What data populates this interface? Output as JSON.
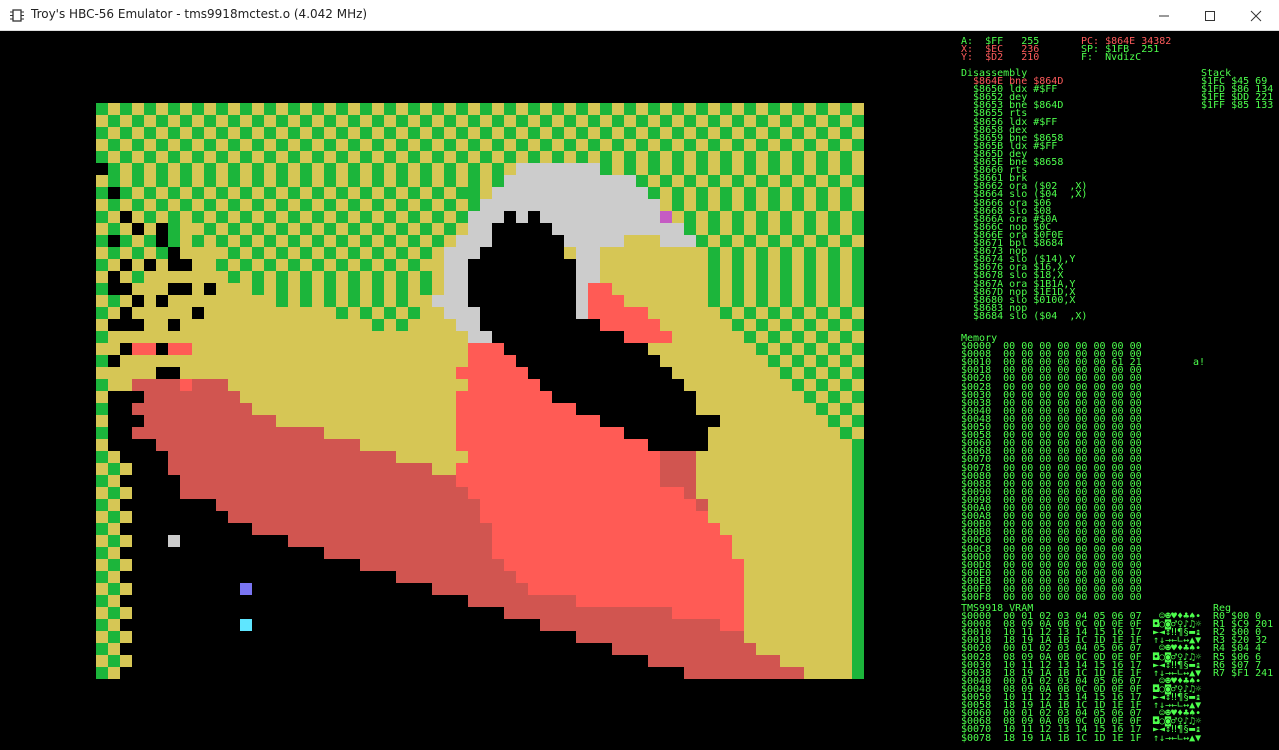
{
  "window": {
    "title": "Troy's HBC-56 Emulator - tms9918mctest.o (4.042 MHz)",
    "icons": {
      "app": "hbc56-chip-icon",
      "minimize": "minimize-icon",
      "maximize": "maximize-icon",
      "close": "close-icon"
    }
  },
  "colors": {
    "debug_green": "#4dff4d",
    "debug_red": "#ff5c5c",
    "palette": {
      "0": "#000000",
      "1": "#1cb53b",
      "2": "#d6c655",
      "3": "#ff5b55",
      "4": "#d15550",
      "5": "#cccccc",
      "6": "#7a75f2",
      "7": "#5fe6ff",
      "8": "#c55bc3",
      "9": "#e2cb84",
      "a": "#45c545"
    }
  },
  "emulator_screen": {
    "description": "TMS9918 multicolor mode bitmap (64x48 blocks)",
    "pixels": [
      "1212121212121212121212121212121212121212121212121212121212121212",
      "2121212121212121212121212121212121212121212121212121212121212121",
      "1212121212121212121212121212121212121212121212121212121212121212",
      "2121212121212121212121212121212121212121212121212121212121212121",
      "1212121212121212121212121212121212121212121212121212121212121212",
      "0121212121212121212121212121212121255555551212121212121212121212",
      "2121212121212121212121212121212121555555555551212121212121212121",
      "1012121212121212121212121212121125555555555555121212121212121212",
      "2121212121212121212121212121212155555555555555521212121212121212",
      "1202121212121212121212121212121555050555555555582121212121212121",
      "2120201221212121212121212121212550000055555555555121212121212121",
      "1012101212121212121212121212125550000005555522255512121212121212",
      "2121210222212121212121212121255500000002552222222221212121212121",
      "1202020022121212121212121212255000000000552222222221212121212121",
      "2021222222212121212121212121255000000000552222222221212121212121",
      "1002220020222121212121212121255000000000533222222221212121212121",
      "2120202222222221212121212122555000000000533322222221212121212121",
      "1202222202222222222212121212255500000000533333222222121212121212",
      "2000220222222222222222212122225500000000003333322222212121212121",
      "1222222222222222222222222222222550000000000033332222221212121212",
      "2203303322222222222222222222222333000000000000222222222121212121",
      "1022222222222222222222222222222333300000000000022222222212121212",
      "2222200222222222222222222222223333330000000000002222222221212121",
      "1224444344422222222222222222222333333000000000000222222222121212",
      "2000444444442222222222222222223333333300000000000022222222212121",
      "1004444444444222222222222222223333333333000000000022222222221212",
      "2000444444444442222222222222223333333333330000000000222222222121",
      "1004444444444444444222222222223333333333333300000002222222222212",
      "2000044444444444444444222222223333333333333333000002222222222221",
      "1200004444444444444444444222222333333333333333344422222222222221",
      "2120004444444444444444444444223333333333333333344422222222222221",
      "1200000444444444444444444444443333333333333333344422222222222221",
      "2120000444444444444444444444444333333333333333333422222222222221",
      "1200000000444444444444444444444433333333333333333342222222222221",
      "2120000000044444444444444444444433333333333333333332222222222221",
      "1200000000000444444444444444444443333333333333333333222222222221",
      "2120005000000000444444444444444443333333333333333333322222222221",
      "1200000000000000000444444444444443333333333333333333322222222221",
      "2120000000000000000000444444444444333333333333333333332222222221",
      "1200000000000000000000000444444444433333333333333333332222222221",
      "2120000000006000000000000000444444443333333333333333332222222221",
      "1200000000000000000000000000000444444444333333333333332222222221",
      "2120000000000000000000000000000000444444444444443333332222222221",
      "1200000000007000000000000000000000000444444444444444332222222221",
      "2120000000000000000000000000000000000000444444444444442222222221",
      "1200000000000000000000000000000000000000000444444444444222222221",
      "2120000000000000000000000000000000000000000000444444444442222221",
      "1200000000000000000000000000000000000000000000000444444444422221"
    ]
  },
  "debugger": {
    "registers": [
      {
        "text": "A:  $FF   255",
        "color": "green"
      },
      {
        "text": "X:  $EC   236",
        "color": "red"
      },
      {
        "text": "Y:  $D2   210",
        "color": "red"
      },
      {
        "text": "PC: $864E 34382",
        "color": "red"
      },
      {
        "text": "SP: $1FB  251",
        "color": "green"
      },
      {
        "text": "F:  NvdizC",
        "color": "green"
      }
    ],
    "disassembly_title": "Disassembly",
    "stack_title": "Stack",
    "disassembly": [
      "  $864E bne $864D",
      "  $8650 ldx #$FF",
      "  $8652 dey",
      "  $8653 bne $864D",
      "  $8655 rts",
      "  $8656 ldx #$FF",
      "  $8658 dex",
      "  $8659 bne $8658",
      "  $865B ldx #$FF",
      "  $865D dey",
      "  $865E bne $8658",
      "  $8660 rts",
      "  $8661 brk",
      "  $8662 ora ($02  ,X)",
      "  $8664 slo ($04  ,X)",
      "  $8666 ora $06",
      "  $8668 slo $08",
      "  $866A ora #$0A",
      "  $866C nop $0C",
      "  $866E ora $0F0E",
      "  $8671 bpl $8684",
      "  $8673 nop",
      "  $8674 slo ($14),Y",
      "  $8676 ora $16,X",
      "  $8678 slo $18,X",
      "  $867A ora $1B1A,Y",
      "  $867D nop $1E1D,X",
      "  $8680 slo $0100,X",
      "  $8683 nop",
      "  $8684 slo ($04  ,X)"
    ],
    "stack": [
      "$1FC $45 69",
      "$1FD $86 134",
      "$1FE $DD 221",
      "$1FF $85 133"
    ],
    "memory_title": "Memory",
    "memory": [
      "$0000  00 00 00 00 00 00 00 00",
      "$0008  00 00 00 00 00 00 00 00",
      "$0010  00 00 00 00 00 00 61 21",
      "$0018  00 00 00 00 00 00 00 00",
      "$0020  00 00 00 00 00 00 00 00",
      "$0028  00 00 00 00 00 00 00 00",
      "$0030  00 00 00 00 00 00 00 00",
      "$0038  00 00 00 00 00 00 00 00",
      "$0040  00 00 00 00 00 00 00 00",
      "$0048  00 00 00 00 00 00 00 00",
      "$0050  00 00 00 00 00 00 00 00",
      "$0058  00 00 00 00 00 00 00 00",
      "$0060  00 00 00 00 00 00 00 00",
      "$0068  00 00 00 00 00 00 00 00",
      "$0070  00 00 00 00 00 00 00 00",
      "$0078  00 00 00 00 00 00 00 00",
      "$0080  00 00 00 00 00 00 00 00",
      "$0088  00 00 00 00 00 00 00 00",
      "$0090  00 00 00 00 00 00 00 00",
      "$0098  00 00 00 00 00 00 00 00",
      "$00A0  00 00 00 00 00 00 00 00",
      "$00A8  00 00 00 00 00 00 00 00",
      "$00B0  00 00 00 00 00 00 00 00",
      "$00B8  00 00 00 00 00 00 00 00",
      "$00C0  00 00 00 00 00 00 00 00",
      "$00C8  00 00 00 00 00 00 00 00",
      "$00D0  00 00 00 00 00 00 00 00",
      "$00D8  00 00 00 00 00 00 00 00",
      "$00E0  00 00 00 00 00 00 00 00",
      "$00E8  00 00 00 00 00 00 00 00",
      "$00F0  00 00 00 00 00 00 00 00",
      "$00F8  00 00 00 00 00 00 00 00"
    ],
    "memory_ascii_row2": "a!",
    "vram_title": "TMS9918 VRAM",
    "reg_title": "Reg",
    "vram": [
      "$0000  00 01 02 03 04 05 06 07",
      "$0008  08 09 0A 0B 0C 0D 0E 0F",
      "$0010  10 11 12 13 14 15 16 17",
      "$0018  18 19 1A 1B 1C 1D 1E 1F",
      "$0020  00 01 02 03 04 05 06 07",
      "$0028  08 09 0A 0B 0C 0D 0E 0F",
      "$0030  10 11 12 13 14 15 16 17",
      "$0038  18 19 1A 1B 1C 1D 1E 1F",
      "$0040  00 01 02 03 04 05 06 07",
      "$0048  08 09 0A 0B 0C 0D 0E 0F",
      "$0050  10 11 12 13 14 15 16 17",
      "$0058  18 19 1A 1B 1C 1D 1E 1F",
      "$0060  00 01 02 03 04 05 06 07",
      "$0068  08 09 0A 0B 0C 0D 0E 0F",
      "$0070  10 11 12 13 14 15 16 17",
      "$0078  18 19 1A 1B 1C 1D 1E 1F"
    ],
    "vram_ascii": [
      " ☺☻♥♦♣♠•",
      "◘○◙♂♀♪♫☼",
      "►◄↕‼¶§▬↨",
      "↑↓→←∟↔▲▼",
      " ☺☻♥♦♣♠•",
      "◘○◙♂♀♪♫☼",
      "►◄↕‼¶§▬↨",
      "↑↓→←∟↔▲▼",
      " ☺☻♥♦♣♠•",
      "◘○◙♂♀♪♫☼",
      "►◄↕‼¶§▬↨",
      "↑↓→←∟↔▲▼",
      " ☺☻♥♦♣♠•",
      "◘○◙♂♀♪♫☼",
      "►◄↕‼¶§▬↨",
      "↑↓→←∟↔▲▼"
    ],
    "vdp_regs": [
      "R0 $00 0",
      "R1 $C9 201",
      "R2 $00 0",
      "R3 $20 32",
      "R4 $04 4",
      "R5 $06 6",
      "R6 $07 7",
      "R7 $F1 241"
    ]
  }
}
